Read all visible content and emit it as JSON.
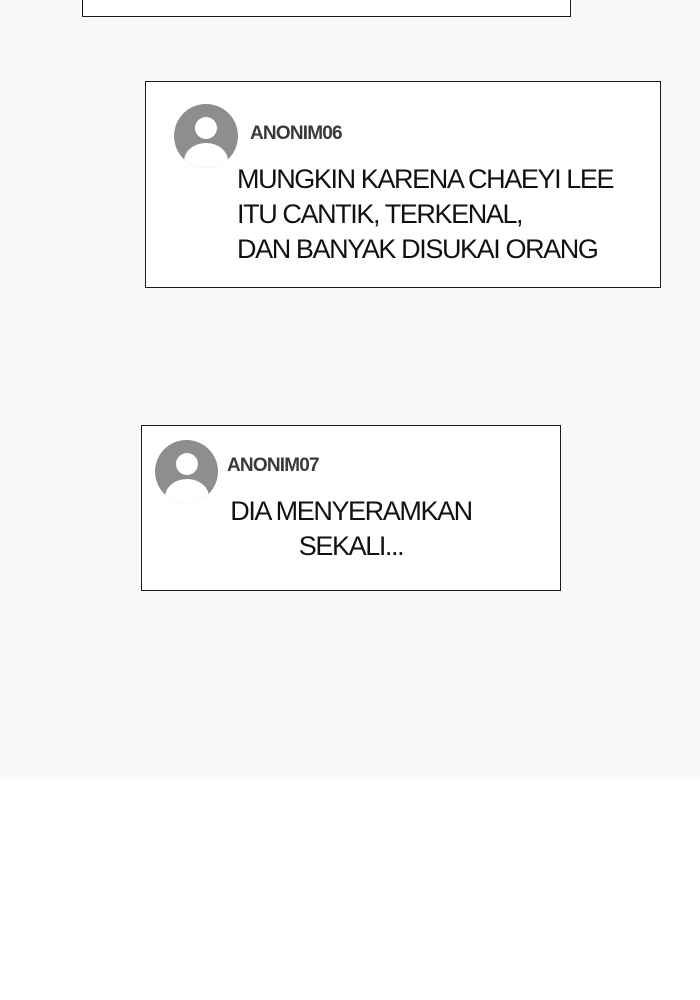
{
  "comments": [
    {
      "username": "ANONIM06",
      "avatar_icon": "user-avatar-icon",
      "lines": [
        "MUNGKIN KARENA CHAEYI LEE",
        "ITU CANTIK, TERKENAL,",
        "DAN BANYAK DISUKAI ORANG"
      ]
    },
    {
      "username": "ANONIM07",
      "avatar_icon": "user-avatar-icon",
      "lines": [
        "DIA MENYERAMKAN",
        "SEKALI..."
      ]
    }
  ],
  "colors": {
    "panel_background": "#f9f9f9",
    "page_background": "#ffffff",
    "avatar": "#8e8e8e",
    "border": "#1a1a1a"
  }
}
